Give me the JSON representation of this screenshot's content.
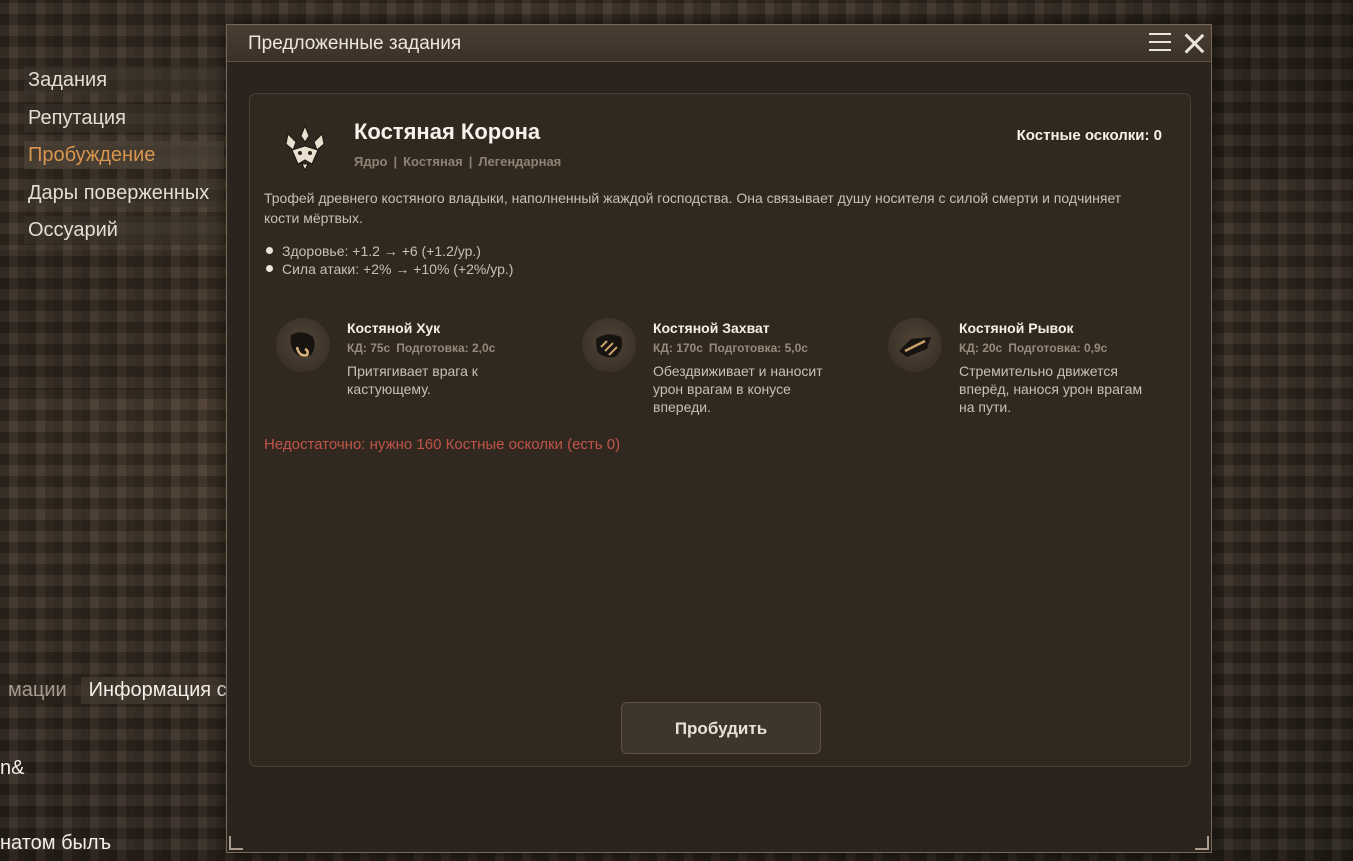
{
  "left_menu": {
    "items": [
      {
        "label": "Задания",
        "active": false
      },
      {
        "label": "Репутация",
        "active": false
      },
      {
        "label": "Пробуждение",
        "active": true
      },
      {
        "label": "Дары поверженных",
        "active": false
      },
      {
        "label": "Оссуарий",
        "active": false
      }
    ]
  },
  "chat": {
    "tabs": [
      "мации",
      "Информация сервера"
    ],
    "lines": [
      "n&",
      "натом былъ"
    ]
  },
  "window": {
    "title": "Предложенные задания",
    "menu_icon": "hamburger-menu-icon",
    "close_icon": "close-icon"
  },
  "item": {
    "icon": "bone-crown-icon",
    "name": "Костяная Корона",
    "tags": [
      "Ядро",
      "Костяная",
      "Легендарная"
    ],
    "currency": "Костные осколки: 0",
    "description": "Трофей древнего костяного владыки, наполненный жаждой господства. Она связывает душу носителя с силой смерти и подчиняет кости мёртвых.",
    "stats": [
      "Здоровье: +1.2 → +6 (+1.2/ур.)",
      "Сила атаки: +2% → +10% (+2%/ур.)"
    ]
  },
  "skills": [
    {
      "name": "Костяной Хук",
      "cd": "КД: 75с",
      "prep": "Подготовка: 2,0с",
      "desc": "Притягивает врага к кастующему.",
      "icon": "bone-hook-icon"
    },
    {
      "name": "Костяной Захват",
      "cd": "КД: 170с",
      "prep": "Подготовка: 5,0с",
      "desc": "Обездвиживает и наносит урон врагам в конусе впереди.",
      "icon": "bone-grasp-icon"
    },
    {
      "name": "Костяной Рывок",
      "cd": "КД: 20с",
      "prep": "Подготовка: 0,9с",
      "desc": "Стремительно движется вперёд, нанося урон врагам на пути.",
      "icon": "bone-dash-icon"
    }
  ],
  "warning": "Недостаточно: нужно 160 Костные осколки (есть 0)",
  "awaken_button": "Пробудить",
  "colors": {
    "accent_active": "#d9964f",
    "warning": "#c0544a",
    "panel": "#2b241e"
  }
}
